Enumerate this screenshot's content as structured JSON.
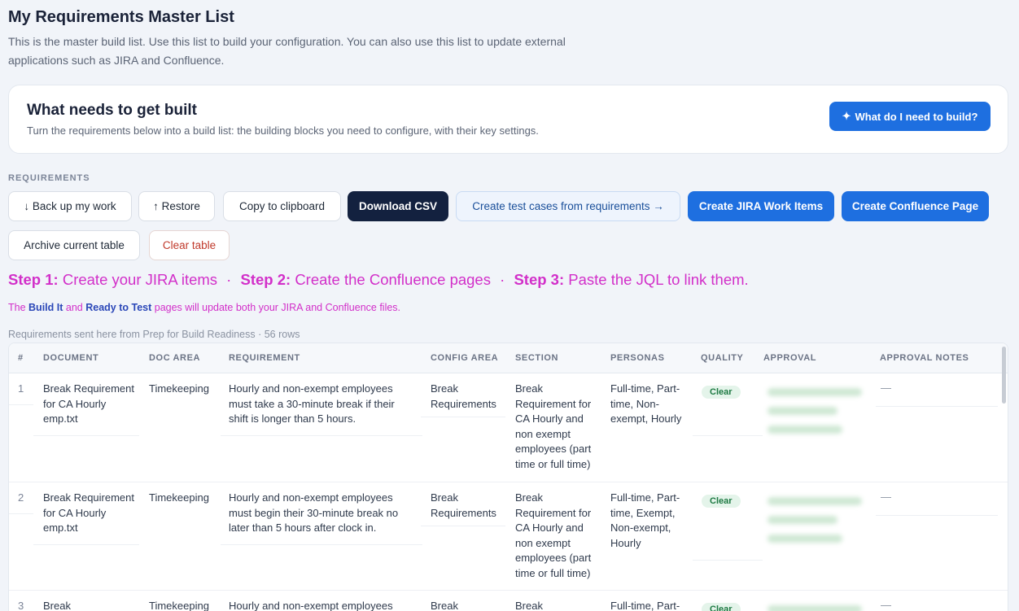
{
  "header": {
    "title": "My Requirements Master List",
    "description": "This is the master build list. Use this list to build your configuration. You can also use this list to update external applications such as JIRA and Confluence."
  },
  "build_card": {
    "title": "What needs to get built",
    "subtitle": "Turn the requirements below into a build list: the building blocks you need to configure, with their key settings.",
    "button_icon": "✦",
    "button_label": "What do I need to build?"
  },
  "requirements_section": {
    "label": "REQUIREMENTS",
    "buttons": {
      "backup": "↓ Back up my work",
      "restore": "↑ Restore",
      "copy": "Copy to clipboard",
      "download": "Download CSV",
      "test_cases": "Create test cases from requirements →",
      "jira": "Create JIRA Work Items",
      "confluence": "Create Confluence Page",
      "archive": "Archive current table",
      "clear": "Clear table"
    }
  },
  "steps": {
    "step1_label": "Step 1:",
    "step1_text": "Create your JIRA items",
    "step2_label": "Step 2:",
    "step2_text": "Create the Confluence pages",
    "step3_label": "Step 3:",
    "step3_text": "Paste the JQL to link them.",
    "separator": "·"
  },
  "note": {
    "prefix": "The",
    "page1": "Build It",
    "and": "and",
    "page2": "Ready to Test",
    "suffix": "pages will update both your JIRA and Confluence files."
  },
  "table_meta": "Requirements sent here from Prep for Build Readiness · 56 rows",
  "table": {
    "columns": [
      "#",
      "DOCUMENT",
      "DOC AREA",
      "REQUIREMENT",
      "CONFIG AREA",
      "SECTION",
      "PERSONAS",
      "QUALITY",
      "APPROVAL",
      "APPROVAL NOTES"
    ],
    "rows": [
      {
        "num": "1",
        "document": "Break Requirement for CA Hourly emp.txt",
        "doc_area": "Timekeeping",
        "requirement": "Hourly and non-exempt employees must take a 30-minute break if their shift is longer than 5 hours.",
        "config_area": "Break Requirements",
        "section": "Break Requirement for CA Hourly and non exempt employees (part time or full time)",
        "personas": "Full-time, Part-time, Non-exempt, Hourly",
        "quality": "Clear",
        "approval_notes": "—"
      },
      {
        "num": "2",
        "document": "Break Requirement for CA Hourly emp.txt",
        "doc_area": "Timekeeping",
        "requirement": "Hourly and non-exempt employees must begin their 30-minute break no later than 5 hours after clock in.",
        "config_area": "Break Requirements",
        "section": "Break Requirement for CA Hourly and non exempt employees (part time or full time)",
        "personas": "Full-time, Part-time, Exempt, Non-exempt, Hourly",
        "quality": "Clear",
        "approval_notes": "—"
      },
      {
        "num": "3",
        "document": "Break",
        "doc_area": "Timekeeping",
        "requirement": "Hourly and non-exempt employees",
        "config_area": "Break",
        "section": "Break",
        "personas": "Full-time, Part-",
        "quality": "Clear",
        "approval_notes": "—"
      }
    ]
  },
  "colors": {
    "accent_blue": "#1e6fe0",
    "dark_navy": "#13213f",
    "step_magenta": "#d22fc9",
    "badge_green": "#1e7a43"
  }
}
